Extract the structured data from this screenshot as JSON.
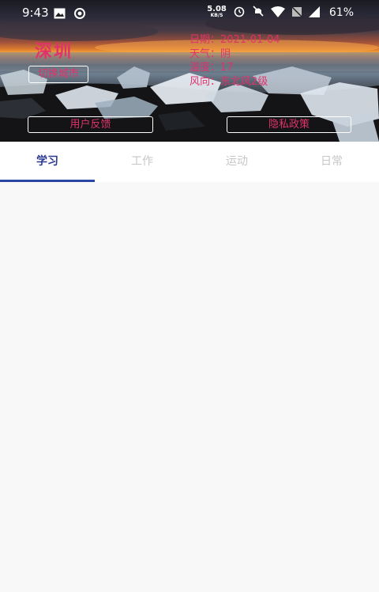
{
  "status_bar": {
    "time": "9:43",
    "net_speed_value": "5.08",
    "net_speed_unit": "KB/S",
    "battery": "61%",
    "icons": [
      "image-icon",
      "data-saver-icon",
      "alarm-icon",
      "mute-icon",
      "wifi-icon",
      "no-sim-icon",
      "signal-icon"
    ]
  },
  "header": {
    "city": "深圳",
    "switch_city_label": "切换城市",
    "weather": {
      "date": "日期：2021-01-04",
      "condition": "天气：阴",
      "temperature": "温度：17",
      "wind": "风向：东北风2级"
    },
    "feedback_label": "用户反馈",
    "privacy_label": "隐私政策"
  },
  "tabs": [
    {
      "label": "学习",
      "active": true
    },
    {
      "label": "工作",
      "active": false
    },
    {
      "label": "运动",
      "active": false
    },
    {
      "label": "日常",
      "active": false
    }
  ],
  "colors": {
    "accent_text": "#e0336b",
    "tab_active": "#2b3a8f",
    "tab_indicator": "#2a45a3",
    "tab_inactive": "#c6c6c6",
    "background": "#f8f8f8"
  }
}
